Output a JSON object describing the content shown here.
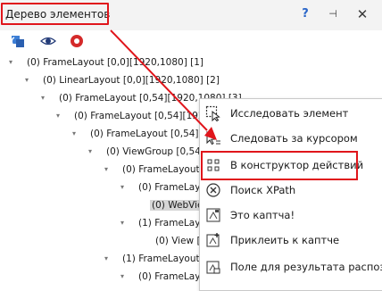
{
  "window": {
    "title": "Дерево элементов",
    "help_label": "?",
    "pin_label": "⊣",
    "close_label": "✕"
  },
  "toolbar": {
    "icons": [
      "refresh-icon",
      "eye-icon",
      "record-stop-icon"
    ]
  },
  "tree": {
    "rows": [
      {
        "text": "(0) FrameLayout [0,0][1920,1080] [1]"
      },
      {
        "text": "(0) LinearLayout [0,0][1920,1080] [2]"
      },
      {
        "text": "(0) FrameLayout [0,54][1920,1080] [3]"
      },
      {
        "text": "(0) FrameLayout [0,54][1920"
      },
      {
        "text": "(0) FrameLayout [0,54][1"
      },
      {
        "text": "(0) ViewGroup [0,54][1"
      },
      {
        "text": "(0) FrameLayout ["
      },
      {
        "text": "(0) FrameLayo"
      },
      {
        "text": "(0) WebVie"
      },
      {
        "text": "(1) FrameLayo"
      },
      {
        "text": "(0) View [0"
      },
      {
        "text": "(1) FrameLayout ["
      },
      {
        "text": "(0) FrameLayou"
      }
    ]
  },
  "context_menu": {
    "items": [
      {
        "label": "Исследовать элемент",
        "icon": "inspect-icon"
      },
      {
        "label": "Следовать за курсором",
        "icon": "follow-cursor-icon"
      },
      {
        "label": "В конструктор действий",
        "icon": "grid-icon"
      },
      {
        "label": "Поиск XPath",
        "icon": "xpath-icon"
      },
      {
        "label": "Это каптча!",
        "icon": "captcha-icon"
      },
      {
        "label": "Приклеить к каптче",
        "icon": "attach-captcha-icon"
      },
      {
        "label": "Поле для результата распозна",
        "icon": "result-field-icon"
      }
    ]
  },
  "colors": {
    "highlight": "#e0151b",
    "accent_blue": "#2a66c9",
    "selection": "#d6d6d6"
  }
}
